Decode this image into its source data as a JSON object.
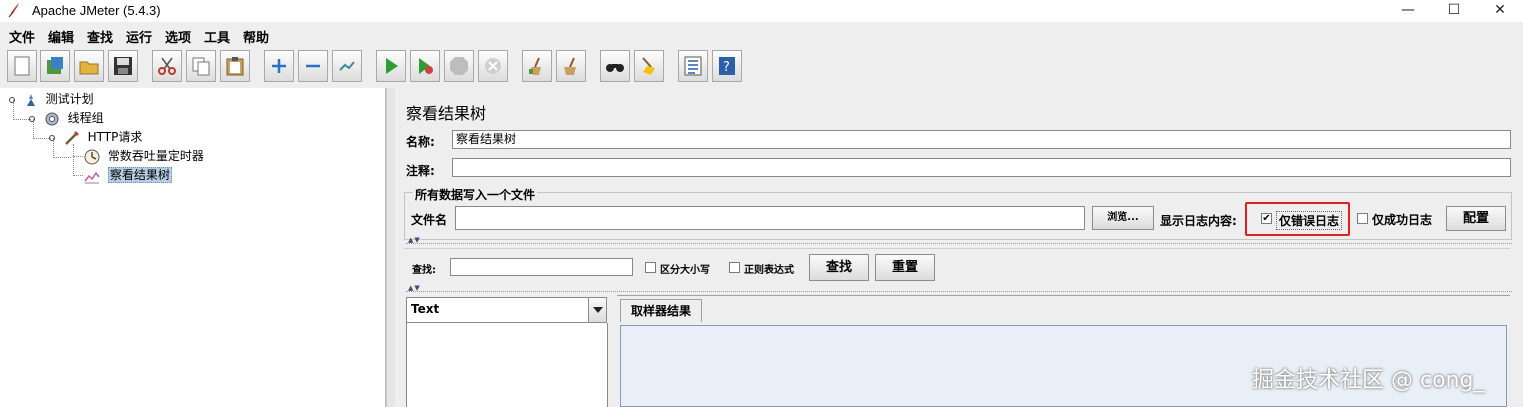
{
  "window": {
    "title": "Apache JMeter (5.4.3)",
    "minimize_glyph": "—",
    "maximize_glyph": "☐",
    "close_glyph": "✕"
  },
  "menubar": {
    "items": [
      "文件",
      "编辑",
      "查找",
      "运行",
      "选项",
      "工具",
      "帮助"
    ]
  },
  "toolbar": {
    "icons": [
      "new-icon",
      "templates-icon",
      "open-icon",
      "save-icon",
      "cut-icon",
      "copy-icon",
      "paste-icon",
      "expand-icon",
      "collapse-icon",
      "toggle-icon",
      "start-icon",
      "start-no-pause-icon",
      "stop-icon",
      "shutdown-icon",
      "clear-icon",
      "clear-all-icon",
      "search-icon",
      "reset-search-icon",
      "function-helper-icon",
      "help-icon"
    ]
  },
  "tree": {
    "nodes": [
      {
        "label": "测试计划",
        "icon": "test-plan-icon"
      },
      {
        "label": "线程组",
        "icon": "thread-group-icon"
      },
      {
        "label": "HTTP请求",
        "icon": "sampler-icon"
      },
      {
        "label": "常数吞吐量定时器",
        "icon": "timer-icon"
      },
      {
        "label": "察看结果树",
        "icon": "listener-icon"
      }
    ]
  },
  "panel": {
    "title": "察看结果树",
    "name_label": "名称:",
    "name_value": "察看结果树",
    "comment_label": "注释:",
    "comment_value": "",
    "file_group_title": "所有数据写入一个文件",
    "filename_label": "文件名",
    "filename_value": "",
    "browse_button": "浏览...",
    "log_display_label": "显示日志内容:",
    "errors_only": {
      "label": "仅错误日志",
      "checked": true
    },
    "successes_only": {
      "label": "仅成功日志",
      "checked": false
    },
    "configure_button": "配置"
  },
  "search": {
    "label": "查找:",
    "value": "",
    "case_sensitive": {
      "label": "区分大小写",
      "checked": false
    },
    "regex": {
      "label": "正则表达式",
      "checked": false
    },
    "find_button": "查找",
    "reset_button": "重置"
  },
  "results": {
    "renderer_selected": "Text",
    "tab_label": "取样器结果"
  },
  "watermark": "掘金技术社区 @ cong_",
  "colors": {
    "highlight": "#e02020",
    "selection": "#b8cfe5",
    "result_bg": "#e9eff7"
  }
}
